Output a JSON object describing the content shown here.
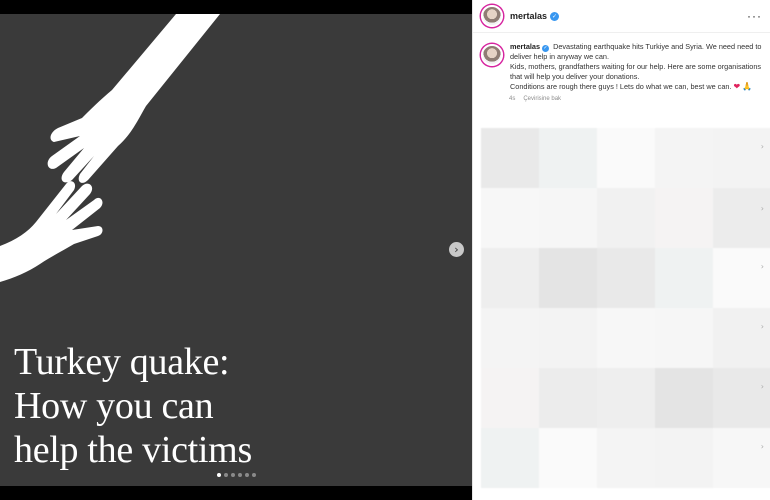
{
  "post": {
    "headline": [
      "Turkey quake:",
      "How you can",
      "help the victims"
    ],
    "carousel": {
      "count": 6,
      "active_index": 0
    },
    "next_icon": "chevron-right-icon"
  },
  "sidebar": {
    "username": "mertalas",
    "more_icon": "more-horizontal-icon",
    "more_label": "···",
    "caption": {
      "username": "mertalas",
      "text_1": "Devastating earthquake hits Turkiye and Syria. We need need to deliver help in anyway we can.",
      "text_2": "Kids, mothers, grandfathers waiting for our help. Here are some organisations that will help you deliver your donations.",
      "text_3": "Conditions are rough there guys ! Lets do what we can, best we can.",
      "emoji_heart": "❤",
      "emoji_pray": "🙏"
    },
    "meta": {
      "time": "4s",
      "translate": "Çevirisine bak"
    }
  },
  "colors": {
    "media_bg": "#3a3a3a",
    "verified": "#3897f0",
    "story_ring": "#d6249f"
  }
}
